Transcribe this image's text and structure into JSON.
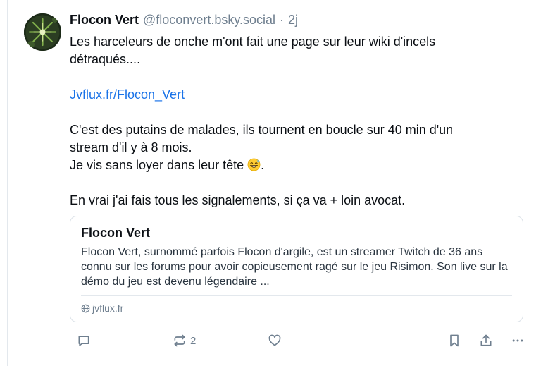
{
  "post": {
    "author": {
      "display_name": "Flocon Vert",
      "handle": "@floconvert.bsky.social",
      "separator": "·",
      "time": "2j"
    },
    "text_lines": [
      "Les harceleurs de onche m'ont fait une page sur leur wiki d'incels",
      "détraqués....",
      "",
      "Jvflux.fr/Flocon_Vert",
      "",
      "C'est des putains de malades, ils tournent en boucle sur 40 min d'un",
      "stream d'il y à 8 mois.",
      "Je vis sans loyer dans leur tête",
      ".",
      "",
      "En vrai j'ai fais tous les signalements, si ça va + loin avocat."
    ],
    "emoji": "grinning-sweat-emoji",
    "link_card": {
      "title": "Flocon Vert",
      "description": "Flocon Vert, surnommé parfois Flocon d'argile, est un streamer Twitch de 36 ans connu sur les forums pour avoir copieusement ragé sur le jeu Risimon. Son live sur la démo du jeu est devenu légendaire ...",
      "domain": "jvflux.fr",
      "domain_icon": "globe-icon"
    },
    "actions": {
      "reply_icon": "reply-icon",
      "repost_icon": "repost-icon",
      "repost_count": "2",
      "like_icon": "heart-icon",
      "bookmark_icon": "bookmark-icon",
      "share_icon": "share-icon",
      "more_icon": "more-icon"
    },
    "colors": {
      "link": "#1a73e8",
      "muted": "#6f7f8f",
      "border": "#dce2e8"
    }
  }
}
